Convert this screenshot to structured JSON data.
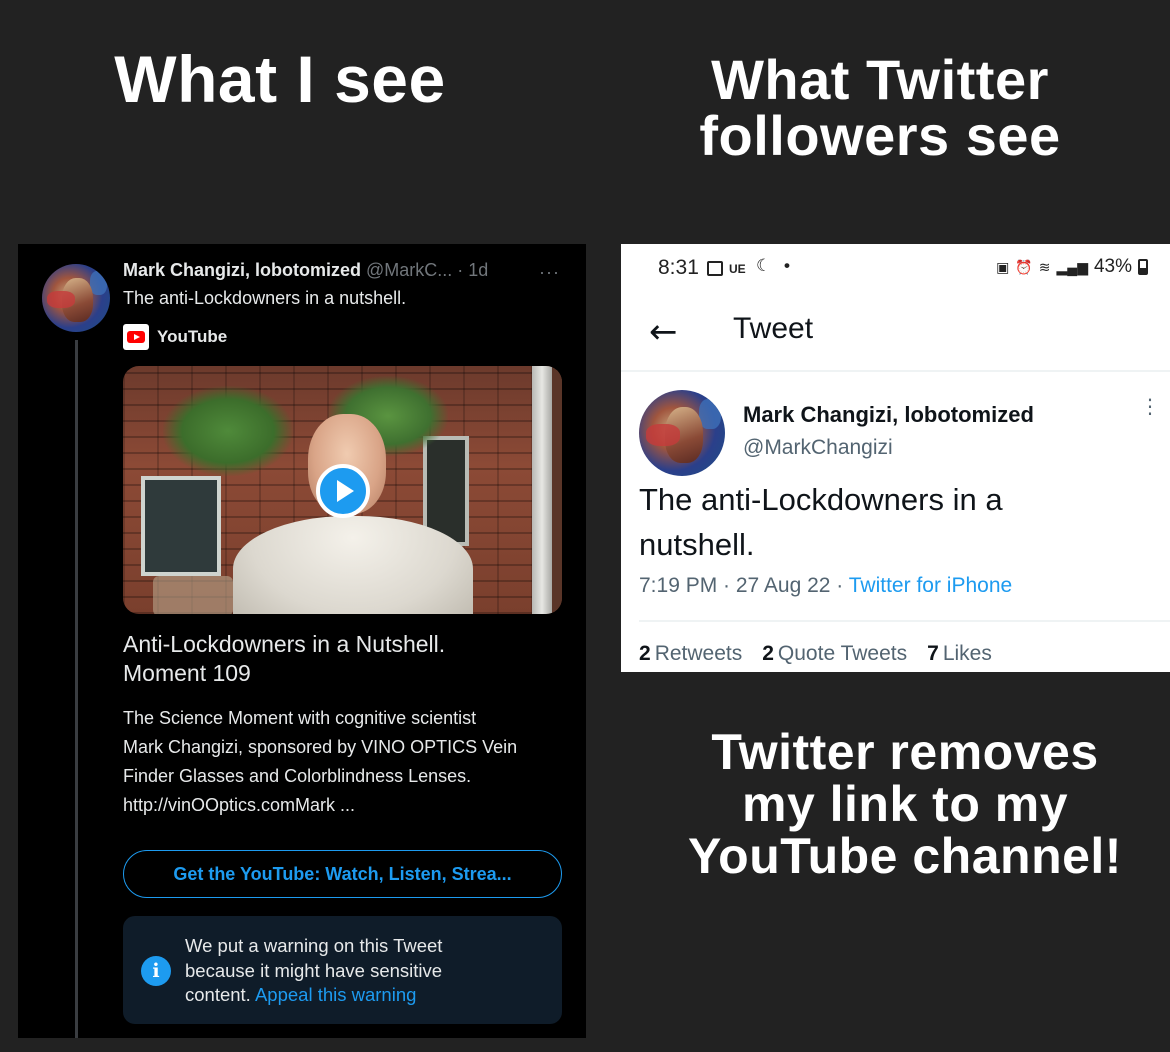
{
  "captions": {
    "left": "What I see",
    "right_line1": "What Twitter",
    "right_line2": "followers see",
    "bottom_line1": "Twitter removes",
    "bottom_line2": "my link to my",
    "bottom_line3": "YouTube channel!"
  },
  "left_tweet": {
    "name": "Mark Changizi, lobotomized",
    "handle_time": "@MarkC... · 1d",
    "more": "···",
    "text": "The anti-Lockdowners in a nutshell.",
    "source_label": "YouTube",
    "video_title_line1": "Anti-Lockdowners in a Nutshell.",
    "video_title_line2": "Moment 109",
    "video_desc_line1": "The Science Moment with cognitive scientist",
    "video_desc_line2": "Mark Changizi, sponsored by VINO OPTICS Vein",
    "video_desc_line3": "Finder Glasses and Colorblindness Lenses.",
    "video_desc_line4": "http://vinOOptics.comMark ...",
    "cta": "Get the YouTube: Watch, Listen, Strea...",
    "warning_line1": "We put a warning on this Tweet",
    "warning_line2": "because it might have sensitive",
    "warning_line3_prefix": "content.",
    "warning_link": "Appeal this warning",
    "info_glyph": "i"
  },
  "right_screen": {
    "status": {
      "time": "8:31",
      "ue": "UE",
      "moon": "☾",
      "dot": "•",
      "battery_pct": "43%"
    },
    "nav": {
      "back": "←",
      "title": "Tweet"
    },
    "tweet": {
      "name": "Mark Changizi, lobotomized",
      "handle": "@MarkChangizi",
      "more": "⋮",
      "text_line1": "The anti-Lockdowners in a",
      "text_line2": "nutshell.",
      "timestamp": "7:19 PM · 27 Aug 22 ·",
      "source": "Twitter for iPhone",
      "stats": [
        {
          "num": "2",
          "label": "Retweets"
        },
        {
          "num": "2",
          "label": "Quote Tweets"
        },
        {
          "num": "7",
          "label": "Likes"
        }
      ]
    }
  },
  "colors": {
    "background": "#222222",
    "twitter_blue": "#1d9bf0",
    "dark_panel": "#000000",
    "warning_bg": "#0f1c29"
  },
  "icons": {
    "play": "play-icon",
    "info": "info-icon",
    "youtube": "youtube-logo-icon",
    "back": "back-arrow-icon"
  }
}
